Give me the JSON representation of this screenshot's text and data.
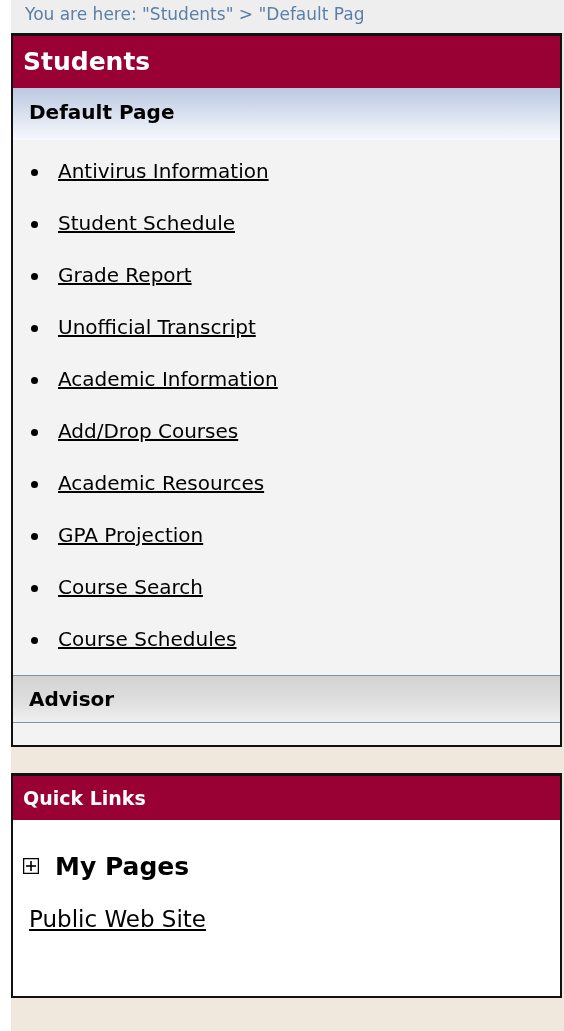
{
  "breadcrumb": "You are here: \"Students\" > \"Default Pag",
  "students": {
    "title": "Students",
    "sections": [
      {
        "title": "Default Page",
        "kind": "current",
        "links": [
          "Antivirus Information",
          "Student Schedule",
          "Grade Report",
          "Unofficial Transcript",
          "Academic Information",
          "Add/Drop Courses",
          "Academic Resources",
          "GPA Projection",
          "Course Search",
          "Course Schedules"
        ]
      },
      {
        "title": "Advisor",
        "kind": "other"
      }
    ]
  },
  "quick_links": {
    "title": "Quick Links",
    "my_pages": {
      "label": "My Pages",
      "expanded": false
    },
    "links": [
      "Public Web Site"
    ]
  }
}
